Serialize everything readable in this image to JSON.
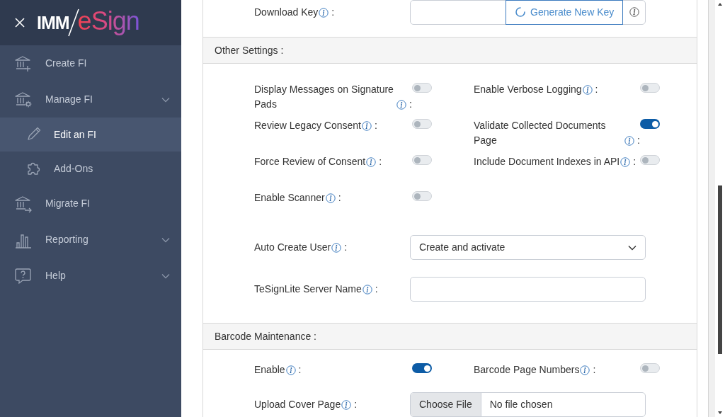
{
  "sidebar": {
    "logo": {
      "prefix": "IMM",
      "wordmark": "eSign"
    },
    "items": [
      {
        "label": "Create FI",
        "kind": "bank-plus",
        "expandable": false,
        "selected": false
      },
      {
        "label": "Manage FI",
        "kind": "bank-gear",
        "expandable": true,
        "selected": false,
        "children": [
          {
            "label": "Edit an FI",
            "kind": "pencil",
            "selected": true
          },
          {
            "label": "Add-Ons",
            "kind": "puzzle",
            "selected": false
          }
        ]
      },
      {
        "label": "Migrate FI",
        "kind": "bank-arrow",
        "expandable": false,
        "selected": false
      },
      {
        "label": "Reporting",
        "kind": "chart",
        "expandable": true,
        "selected": false
      },
      {
        "label": "Help",
        "kind": "help",
        "expandable": true,
        "selected": false
      }
    ]
  },
  "download_key": {
    "label": "Download Key",
    "colon": ":",
    "button": "Generate New Key"
  },
  "sections": [
    {
      "title": "Other Settings :",
      "rows": [
        [
          {
            "kind": "toggle",
            "label": "Display Messages on Signature Pads",
            "colon": ":",
            "on": false
          },
          {
            "kind": "toggle",
            "label": "Enable Verbose Logging",
            "colon": ":",
            "on": false
          }
        ],
        [
          {
            "kind": "toggle",
            "label": "Review Legacy Consent",
            "colon": ":",
            "on": false
          },
          {
            "kind": "toggle",
            "label": "Validate Collected Documents Page",
            "colon": ":",
            "on": true
          }
        ],
        [
          {
            "kind": "toggle",
            "label": "Force Review of Consent",
            "colon": ":",
            "on": false
          },
          {
            "kind": "toggle",
            "label": "Include Document Indexes in API",
            "colon": ":",
            "on": false
          }
        ],
        [
          {
            "kind": "toggle",
            "label": "Enable Scanner",
            "colon": ":",
            "on": false
          }
        ],
        [
          {
            "kind": "select",
            "label": "Auto Create User",
            "colon": ":",
            "value": "Create and activate"
          }
        ],
        [
          {
            "kind": "text",
            "label": "TeSignLite Server Name",
            "colon": ":"
          }
        ]
      ]
    },
    {
      "title": "Barcode Maintenance :",
      "rows": [
        [
          {
            "kind": "toggle",
            "label": "Enable",
            "colon": ":",
            "on": true
          },
          {
            "kind": "toggle",
            "label": "Barcode Page Numbers",
            "colon": ":",
            "on": false
          }
        ],
        [
          {
            "kind": "file",
            "label": "Upload Cover Page",
            "colon": ":",
            "button": "Choose File",
            "status": "No file chosen"
          }
        ]
      ]
    }
  ]
}
